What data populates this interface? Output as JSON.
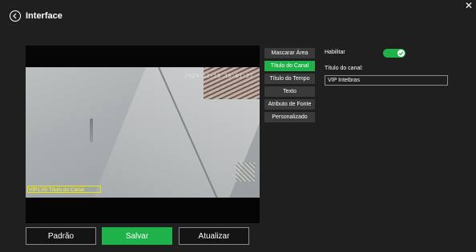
{
  "header": {
    "title": "Interface",
    "back_icon": "chevron-left-circle-icon",
    "close_icon": "close-icon"
  },
  "preview": {
    "timestamp": "2024-12-19 15:01:27",
    "channel_osd": "VIP1.00 Título do Canal",
    "osd_color": "#ffff00"
  },
  "menu": {
    "items": [
      {
        "label": "Mascarar Área",
        "active": false
      },
      {
        "label": "Título do Canal",
        "active": true
      },
      {
        "label": "Título do Tempo",
        "active": false
      },
      {
        "label": "Texto",
        "active": false
      },
      {
        "label": "Atributo de Fonte",
        "active": false
      },
      {
        "label": "Personalizado",
        "active": false
      }
    ]
  },
  "settings": {
    "enable_label": "Habilitar",
    "enabled": true,
    "channel_title_label": "Título do canal:",
    "channel_title_value": "VIP Intelbras"
  },
  "buttons": {
    "default": "Padrão",
    "save": "Salvar",
    "refresh": "Atualizar"
  },
  "colors": {
    "accent": "#1fb24a",
    "background": "#1f1f1f"
  }
}
